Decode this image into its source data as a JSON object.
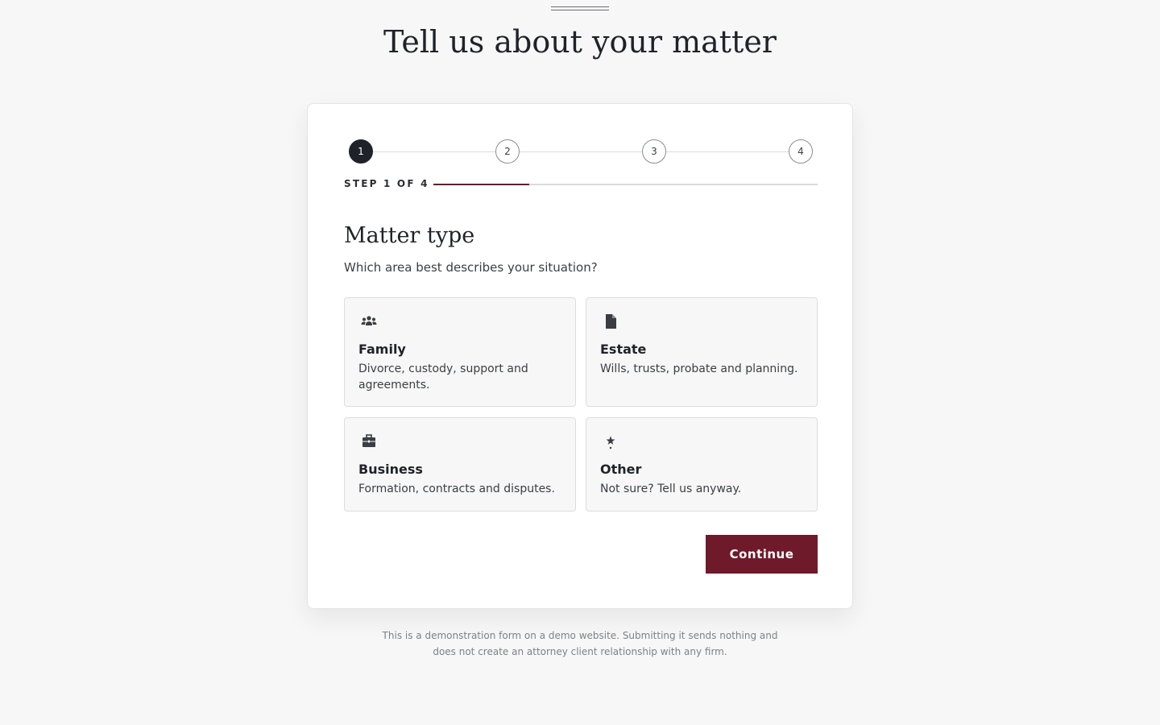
{
  "page": {
    "title": "Tell us about your matter"
  },
  "stepper": {
    "steps": [
      "1",
      "2",
      "3",
      "4"
    ],
    "current_step": 1,
    "step_label": "STEP 1 OF 4",
    "progress": 0.25
  },
  "section": {
    "title": "Matter type",
    "subtitle": "Which area best describes your situation?"
  },
  "options": [
    {
      "icon": "people-icon",
      "title": "Family",
      "description": "Divorce, custody, support and agreements."
    },
    {
      "icon": "document-icon",
      "title": "Estate",
      "description": "Wills, trusts, probate and planning."
    },
    {
      "icon": "briefcase-icon",
      "title": "Business",
      "description": "Formation, contracts and disputes."
    },
    {
      "icon": "star-icon",
      "title": "Other",
      "description": "Not sure? Tell us anyway."
    }
  ],
  "actions": {
    "continue_label": "Continue"
  },
  "footer": {
    "disclaimer": "This is a demonstration form on a demo website. Submitting it sends nothing and does not create an attorney client relationship with any firm."
  },
  "colors": {
    "accent": "#6f1a2b",
    "dark": "#1f2329",
    "background": "#f7f7f7"
  }
}
